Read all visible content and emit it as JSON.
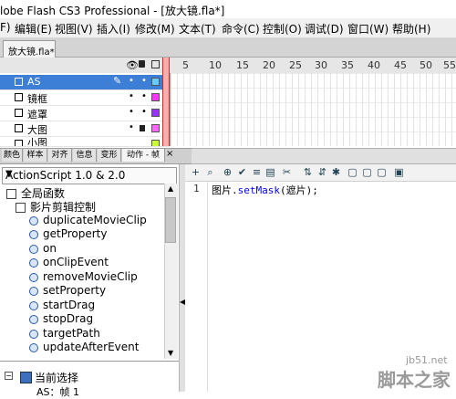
{
  "window": {
    "title": "lobe Flash CS3 Professional - [放大镜.fla*]"
  },
  "menu": {
    "items": [
      "F)",
      "编辑(E)",
      "视图(V)",
      "插入(I)",
      "修改(M)",
      "文本(T)",
      "命令(C)",
      "控制(O)",
      "调试(D)",
      "窗口(W)",
      "帮助(H)"
    ]
  },
  "document_tab": {
    "label": "放大镜.fla*"
  },
  "timeline": {
    "ruler": [
      "5",
      "10",
      "15",
      "20",
      "25",
      "30",
      "35",
      "40",
      "45",
      "50",
      "55"
    ],
    "layers": [
      {
        "name": "AS",
        "selected": true,
        "color": "#66ccff"
      },
      {
        "name": "镜框",
        "selected": false,
        "color": "#ff33ff"
      },
      {
        "name": "遮罩",
        "selected": false,
        "color": "#9933ff"
      },
      {
        "name": "大图",
        "selected": false,
        "color": "#ff66ff"
      },
      {
        "name": "小图",
        "selected": false,
        "color": "#ccff33"
      }
    ]
  },
  "panel_tabs": [
    "颜色",
    "样本",
    "对齐",
    "信息",
    "变形",
    "动作 - 帧"
  ],
  "actions_panel": {
    "version": "ActionScript 1.0 & 2.0",
    "tree_root": "全局函数",
    "tree_category": "影片剪辑控制",
    "functions": [
      "duplicateMovieClip",
      "getProperty",
      "on",
      "onClipEvent",
      "removeMovieClip",
      "setProperty",
      "startDrag",
      "stopDrag",
      "targetPath",
      "updateAfterEvent"
    ],
    "bottom_root": "当前选择",
    "bottom_item": "AS：帧 1"
  },
  "editor": {
    "line_number": "1",
    "code_prefix": "图片.",
    "code_method": "setMask",
    "code_suffix": "(遮片);"
  },
  "watermark": {
    "site": "jb51.net",
    "brand": "脚本之家"
  }
}
